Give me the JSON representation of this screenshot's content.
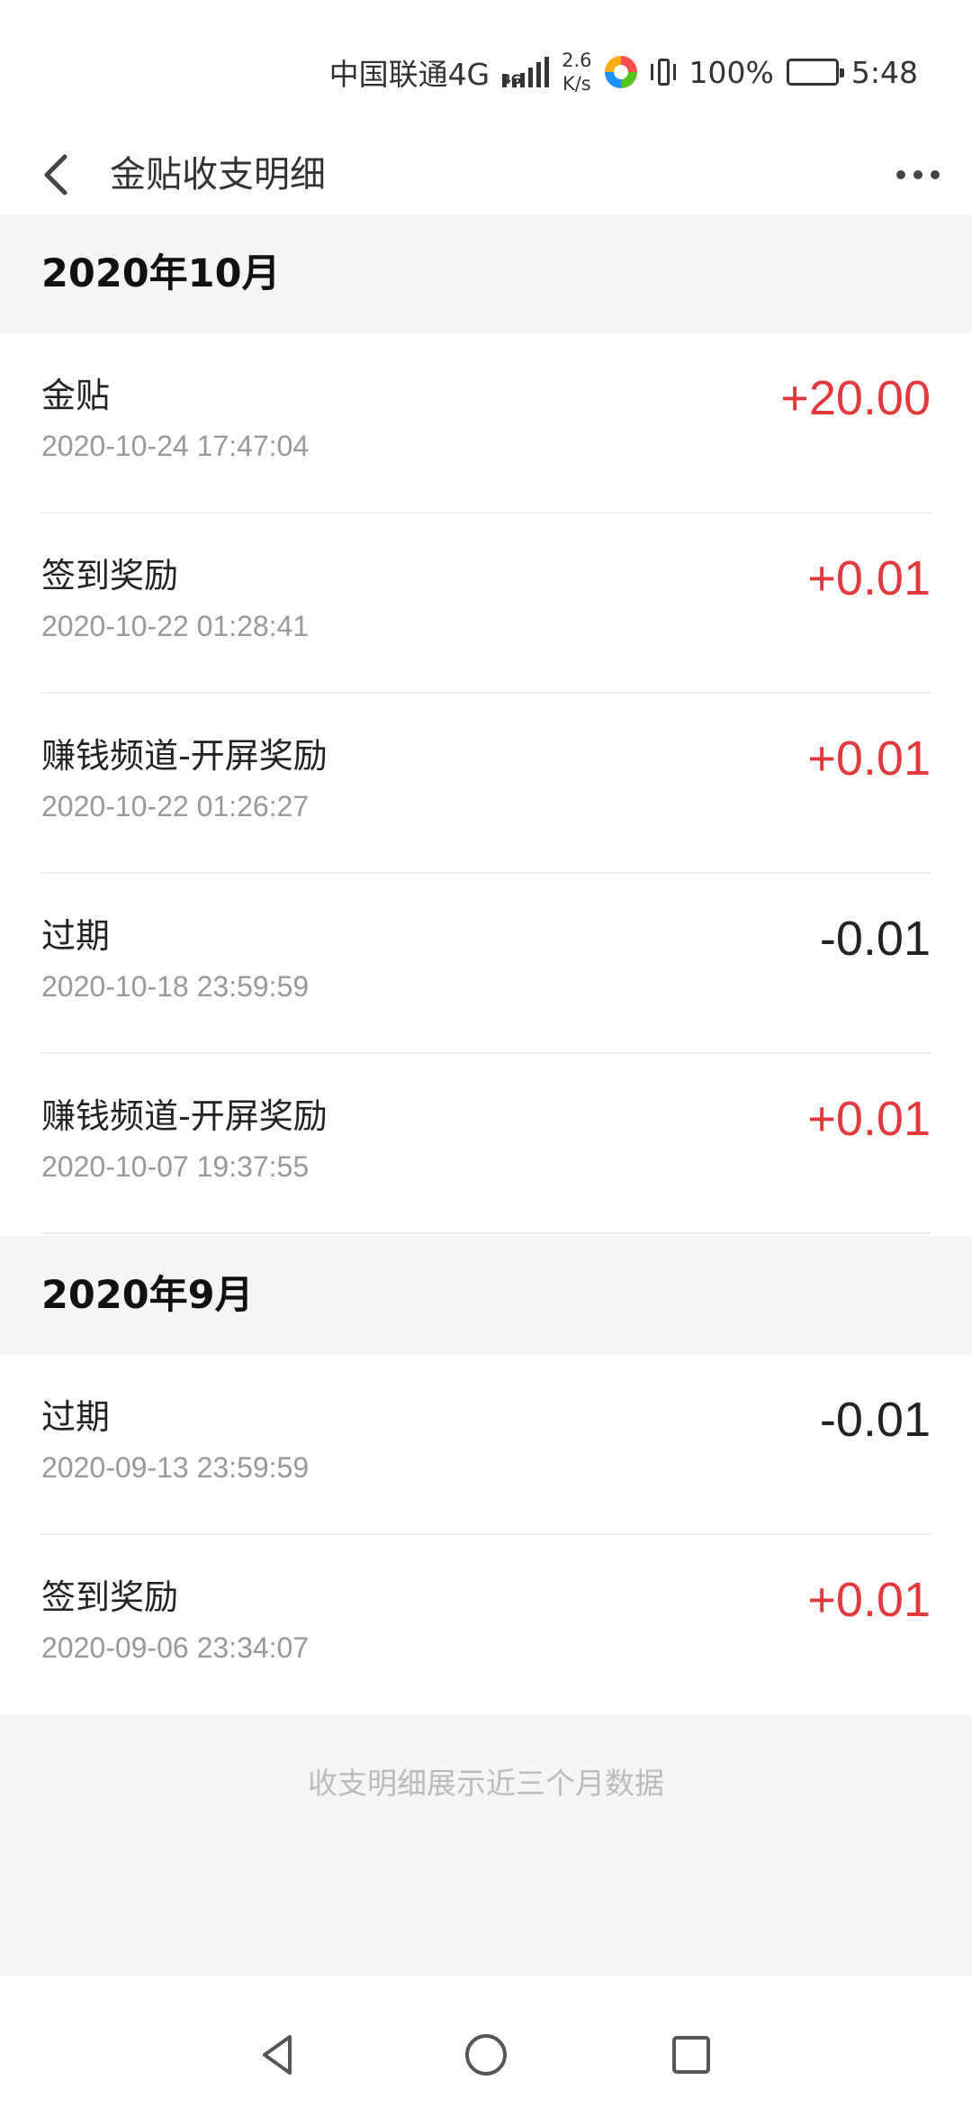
{
  "status_bar": {
    "carrier": "中国联通4G",
    "network_badge": "4G",
    "net_speed_value": "2.6",
    "net_speed_unit": "K/s",
    "battery": "100%",
    "time": "5:48",
    "icons": [
      "signal-icon",
      "app-icon",
      "vibrate-icon",
      "battery-icon"
    ]
  },
  "header": {
    "title": "金贴收支明细",
    "back_icon": "chevron-left-icon",
    "more_icon": "more-dots-icon"
  },
  "months": [
    {
      "label": "2020年10月",
      "records": [
        {
          "title": "金贴",
          "time": "2020-10-24 17:47:04",
          "amount": "+20.00",
          "type": "income"
        },
        {
          "title": "签到奖励",
          "time": "2020-10-22 01:28:41",
          "amount": "+0.01",
          "type": "income"
        },
        {
          "title": "赚钱频道-开屏奖励",
          "time": "2020-10-22 01:26:27",
          "amount": "+0.01",
          "type": "income"
        },
        {
          "title": "过期",
          "time": "2020-10-18 23:59:59",
          "amount": "-0.01",
          "type": "expense"
        },
        {
          "title": "赚钱频道-开屏奖励",
          "time": "2020-10-07 19:37:55",
          "amount": "+0.01",
          "type": "income"
        }
      ]
    },
    {
      "label": "2020年9月",
      "records": [
        {
          "title": "过期",
          "time": "2020-09-13 23:59:59",
          "amount": "-0.01",
          "type": "expense"
        },
        {
          "title": "签到奖励",
          "time": "2020-09-06 23:34:07",
          "amount": "+0.01",
          "type": "income"
        }
      ]
    }
  ],
  "footer_note": "收支明细展示近三个月数据",
  "colors": {
    "income": "#e4393c",
    "expense": "#222222",
    "section_bg": "#f5f5f5"
  },
  "nav_bar": {
    "icons": [
      "nav-back-icon",
      "nav-home-icon",
      "nav-recent-icon"
    ]
  }
}
